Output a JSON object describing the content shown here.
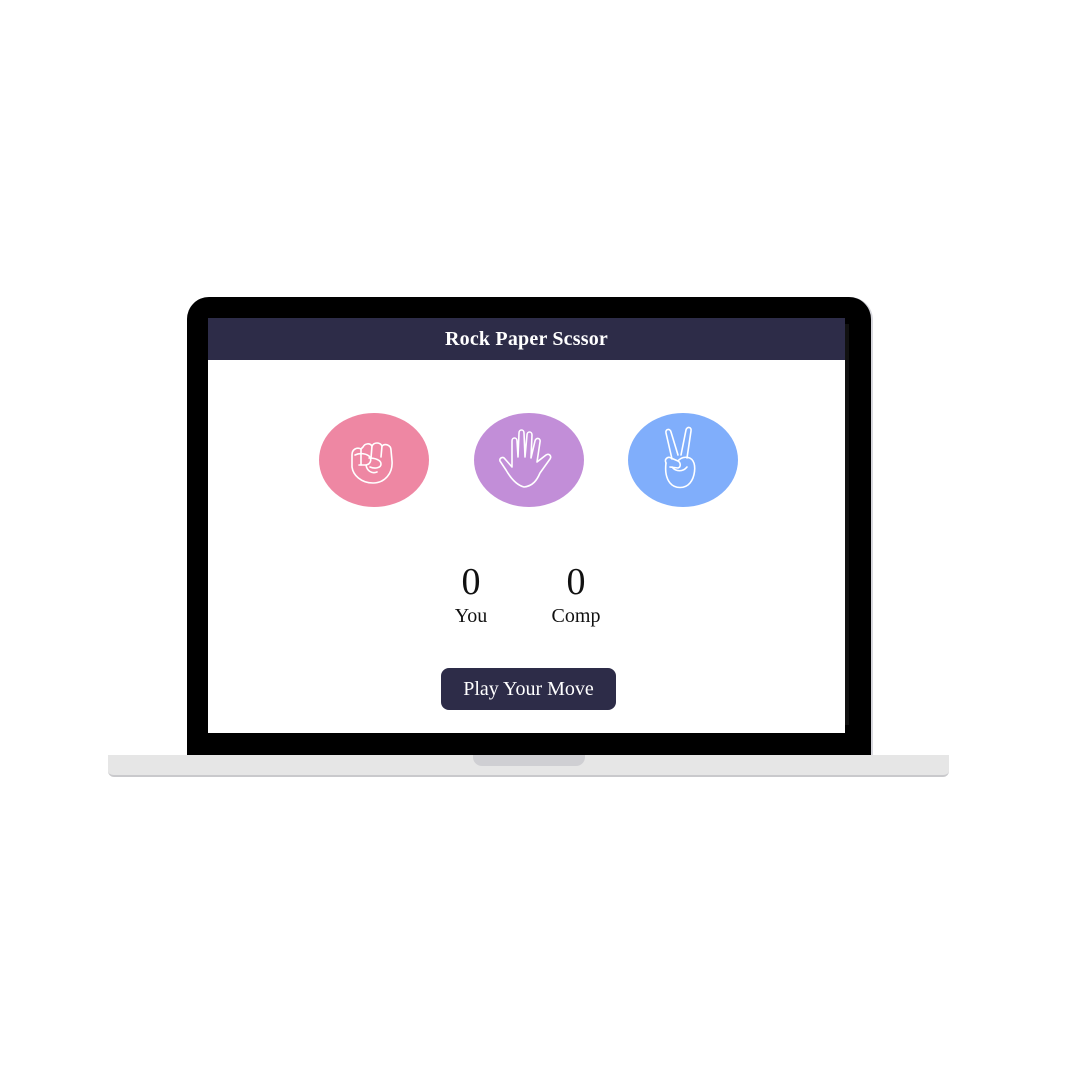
{
  "app": {
    "title": "Rock Paper Scssor"
  },
  "choices": [
    {
      "name": "rock",
      "icon": "fist-icon",
      "color": "#ee87a3"
    },
    {
      "name": "paper",
      "icon": "open-hand-icon",
      "color": "#c28ed8"
    },
    {
      "name": "scissors",
      "icon": "peace-hand-icon",
      "color": "#80aefb"
    }
  ],
  "scoreboard": {
    "user_score": "0",
    "user_label": "You",
    "comp_score": "0",
    "comp_label": "Comp"
  },
  "action": {
    "play_label": "Play Your Move"
  },
  "colors": {
    "header_bg": "#2d2c48",
    "button_bg": "#2d2c48"
  }
}
